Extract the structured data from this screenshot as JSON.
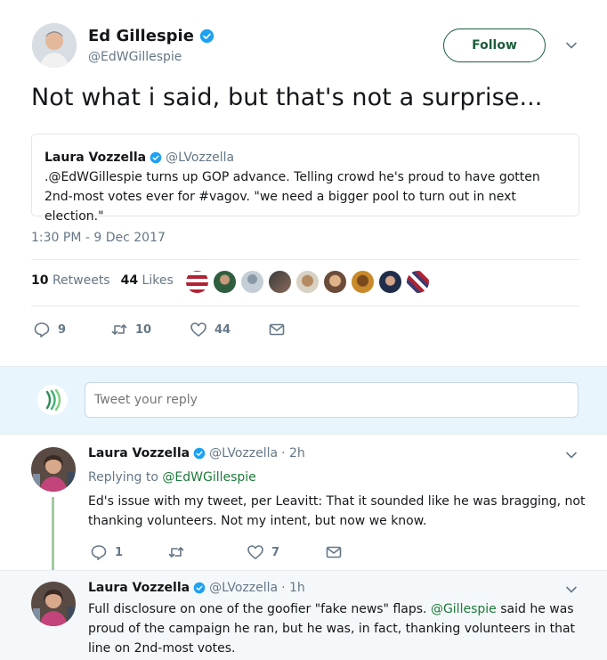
{
  "tweet": {
    "author_name": "Ed Gillespie",
    "author_handle": "@EdWGillespie",
    "follow_label": "Follow",
    "text": "Not what i said, but that's not a surprise...",
    "timestamp": "1:30 PM - 9 Dec 2017",
    "retweets_count": "10",
    "retweets_label": "Retweets",
    "likes_count": "44",
    "likes_label": "Likes",
    "reply_count": "9",
    "retweet_count": "10",
    "like_count": "44"
  },
  "quote": {
    "author_name": "Laura Vozzella",
    "author_handle": "@LVozzella",
    "text": ".@EdWGillespie turns up GOP advance. Telling crowd he's proud to have gotten 2nd-most votes ever for #vagov. \"we need a bigger pool to turn out in next election.\""
  },
  "reply_box": {
    "placeholder": "Tweet your reply"
  },
  "replies": [
    {
      "author_name": "Laura Vozzella",
      "author_handle": "@LVozzella",
      "time": "· 2h",
      "replying_prefix": "Replying to",
      "replying_to": "@EdWGillespie",
      "text_line1": "Ed's issue with my tweet, per Leavitt: That it sounded like he was bragging, not",
      "text_line2": "thanking volunteers. Not my intent, but now we know.",
      "reply_count": "1",
      "retweet_count": "",
      "like_count": "7"
    },
    {
      "author_name": "Laura Vozzella",
      "author_handle": "@LVozzella",
      "time": "· 1h",
      "text_line1_pre": "Full disclosure on one of the goofier \"fake news\" flaps.",
      "mention": "@Gillespie",
      "text_line1_post": "said he was",
      "text_line2": "proud of the campaign he ran, but he was, in fact, thanking volunteers in that",
      "text_line3": "line on 2nd-most votes."
    }
  ],
  "colors": {
    "accent": "#1b5e3b",
    "link": "#1c7a3a",
    "verified": "#1da1f2",
    "thread_line": "#a3c9a0",
    "reply_bar_bg": "#e8f5fd"
  },
  "icons": [
    "verified-badge-icon",
    "chevron-down-icon",
    "reply-icon",
    "retweet-icon",
    "heart-icon",
    "mail-icon",
    "site-logo-icon"
  ]
}
